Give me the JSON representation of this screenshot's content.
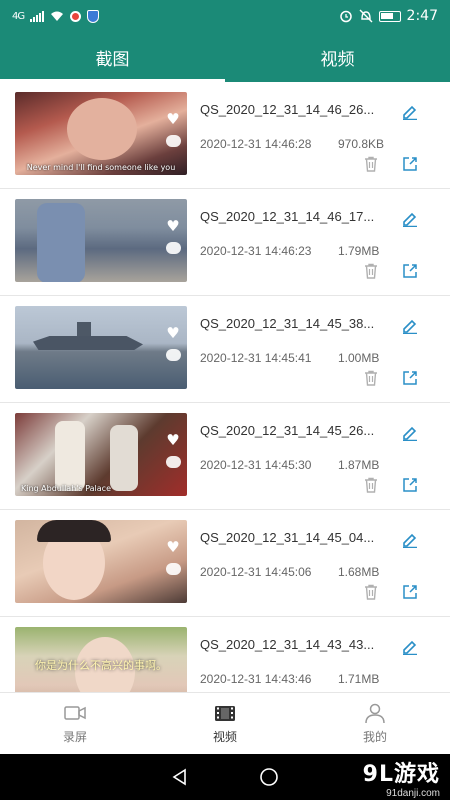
{
  "status_bar": {
    "network": "4G",
    "time": "2:47"
  },
  "tabs": [
    {
      "label": "截图",
      "active": true
    },
    {
      "label": "视频",
      "active": false
    }
  ],
  "videos": [
    {
      "title": "QS_2020_12_31_14_46_26...",
      "date": "2020-12-31 14:46:28",
      "size": "970.8KB"
    },
    {
      "title": "QS_2020_12_31_14_46_17...",
      "date": "2020-12-31 14:46:23",
      "size": "1.79MB"
    },
    {
      "title": "QS_2020_12_31_14_45_38...",
      "date": "2020-12-31 14:45:41",
      "size": "1.00MB"
    },
    {
      "title": "QS_2020_12_31_14_45_26...",
      "date": "2020-12-31 14:45:30",
      "size": "1.87MB"
    },
    {
      "title": "QS_2020_12_31_14_45_04...",
      "date": "2020-12-31 14:45:06",
      "size": "1.68MB"
    },
    {
      "title": "QS_2020_12_31_14_43_43...",
      "date": "2020-12-31 14:43:46",
      "size": "1.71MB"
    }
  ],
  "thumb_captions": {
    "t1": "Never mind I'll find someone like you",
    "t4": "King Abdullah's Palace",
    "t6": "你是为什么不高兴的事啊。"
  },
  "bottom_nav": [
    {
      "label": "录屏",
      "icon": "camera-icon",
      "active": false
    },
    {
      "label": "视频",
      "icon": "film-icon",
      "active": true
    },
    {
      "label": "我的",
      "icon": "person-icon",
      "active": false
    }
  ],
  "watermark": {
    "logo": "9L游戏",
    "url": "91danji.com"
  },
  "colors": {
    "primary": "#1b8a77",
    "action_icon": "#2a8fc7"
  }
}
